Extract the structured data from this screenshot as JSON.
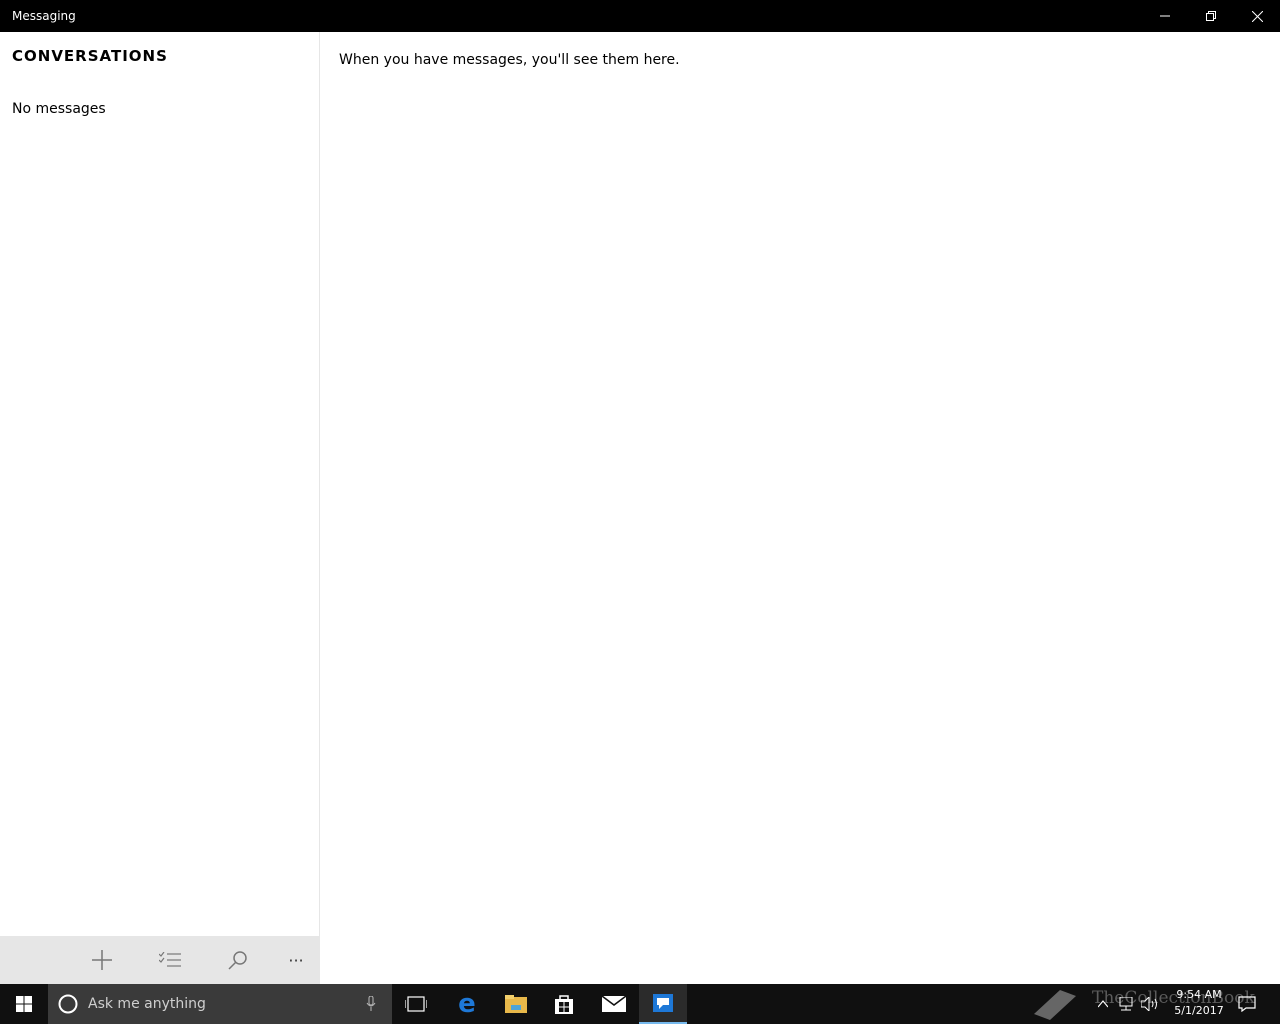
{
  "window": {
    "title": "Messaging"
  },
  "sidebar": {
    "heading": "CONVERSATIONS",
    "empty_text": "No messages",
    "commands": [
      {
        "icon": "add-icon"
      },
      {
        "icon": "select-list-icon"
      },
      {
        "icon": "search-icon"
      },
      {
        "icon": "more-icon",
        "label": "···"
      }
    ]
  },
  "main": {
    "empty_hint": "When you have messages, you'll see them here."
  },
  "taskbar": {
    "search_placeholder": "Ask me anything",
    "apps": [
      "task-view-icon",
      "edge-icon",
      "file-explorer-icon",
      "store-icon",
      "mail-icon",
      "messaging-icon"
    ],
    "clock": {
      "time": "9:54 AM",
      "date": "5/1/2017"
    },
    "watermark": "TheCollectionBook"
  },
  "colors": {
    "titlebar": "#000000",
    "taskbar": "#101010",
    "accent": "#76b9ed",
    "edge_blue": "#1e78d7"
  }
}
